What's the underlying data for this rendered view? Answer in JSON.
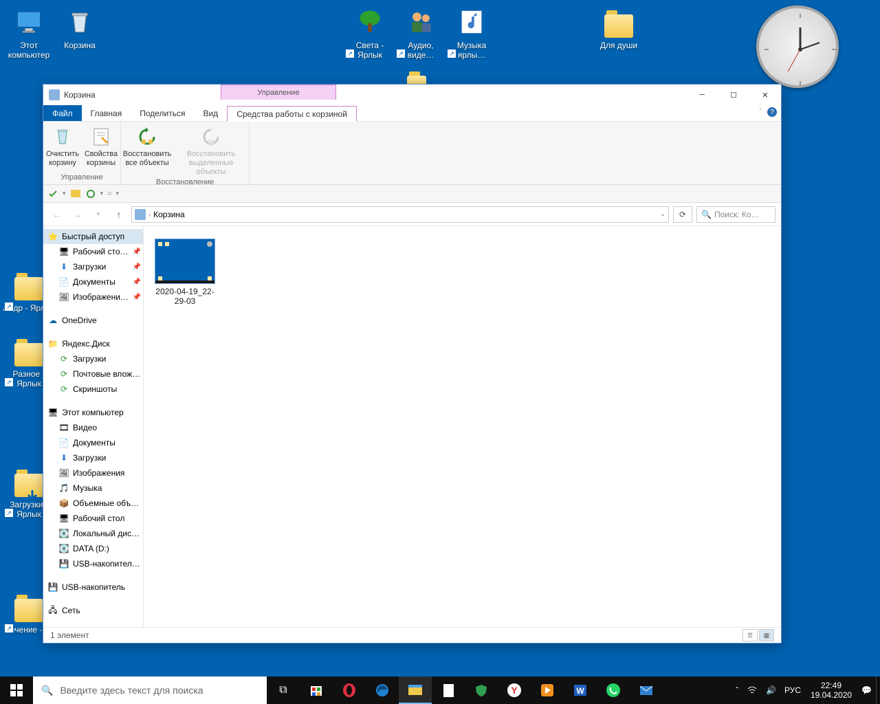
{
  "desktop": {
    "icons": [
      {
        "label": "Этот компьютер",
        "name": "this-pc"
      },
      {
        "label": "Корзина",
        "name": "recycle-bin"
      },
      {
        "label": "Света - Ярлык",
        "name": "sveta-shortcut"
      },
      {
        "label": "Аудио, виде…",
        "name": "audio-video-shortcut"
      },
      {
        "label": "Музыка ярлы…",
        "name": "music-shortcut"
      },
      {
        "label": "Для души",
        "name": "dlya-dushi"
      },
      {
        "label": "Алдр - Ярлык",
        "name": "aldr-shortcut"
      },
      {
        "label": "Разное - Ярлык",
        "name": "raznoe-shortcut"
      },
      {
        "label": "Загрузки - Ярлык",
        "name": "downloads-shortcut"
      },
      {
        "label": "Лечение - …",
        "name": "lechenie-shortcut"
      }
    ]
  },
  "window": {
    "title": "Корзина",
    "manage_tab": "Управление",
    "tabs": {
      "file": "Файл",
      "home": "Главная",
      "share": "Поделиться",
      "view": "Вид",
      "tools": "Средства работы с корзиной"
    },
    "ribbon": {
      "empty": "Очистить корзину",
      "props": "Свойства корзины",
      "restore_all": "Восстановить все объекты",
      "restore_sel": "Восстановить выделенные объекты",
      "group1": "Управление",
      "group2": "Восстановление"
    },
    "breadcrumb": "Корзина",
    "search_placeholder": "Поиск: Ко…",
    "tree": {
      "quick": "Быстрый доступ",
      "quick_items": [
        "Рабочий сто…",
        "Загрузки",
        "Документы",
        "Изображени…"
      ],
      "onedrive": "OneDrive",
      "yandex": "Яндекс.Диск",
      "yandex_items": [
        "Загрузки",
        "Почтовые влож…",
        "Скриншоты"
      ],
      "thispc": "Этот компьютер",
      "pc_items": [
        "Видео",
        "Документы",
        "Загрузки",
        "Изображения",
        "Музыка",
        "Объемные объ…",
        "Рабочий стол",
        "Локальный дис…",
        "DATA (D:)",
        "USB-накопител…"
      ],
      "usb": "USB-накопитель",
      "network": "Сеть"
    },
    "file": {
      "name": "2020-04-19_22-29-03"
    },
    "status": "1 элемент"
  },
  "taskbar": {
    "search_placeholder": "Введите здесь текст для поиска",
    "lang": "РУС",
    "time": "22:49",
    "date": "19.04.2020"
  }
}
